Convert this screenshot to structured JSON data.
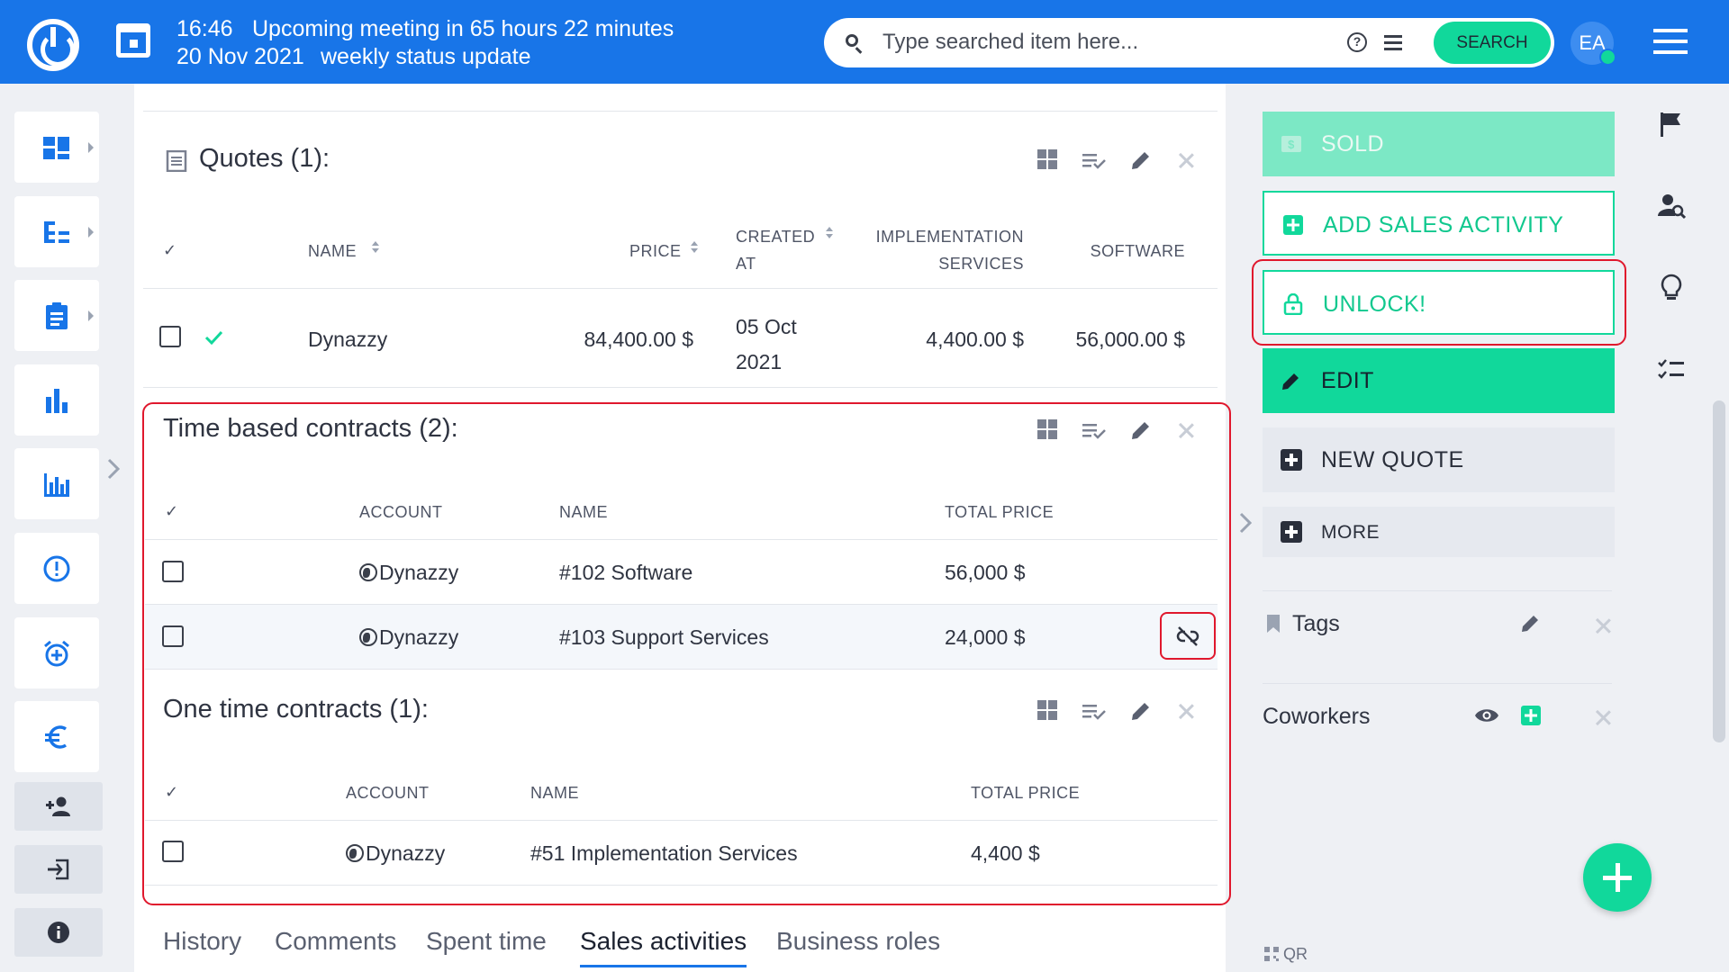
{
  "header": {
    "time": "16:46",
    "date": "20 Nov 2021",
    "meeting_line1": "Upcoming meeting in 65 hours 22 minutes",
    "meeting_line2": "weekly status update",
    "search_placeholder": "Type searched item here...",
    "search_button": "SEARCH",
    "avatar_initials": "EA"
  },
  "quotes": {
    "title": "Quotes (1):",
    "columns": {
      "check": "✓",
      "name": "NAME",
      "price": "PRICE",
      "created_1": "CREATED",
      "created_2": "AT",
      "impl_1": "IMPLEMENTATION",
      "impl_2": "SERVICES",
      "software": "SOFTWARE"
    },
    "rows": [
      {
        "name": "Dynazzy",
        "price": "84,400.00 $",
        "created_1": "05 Oct",
        "created_2": "2021",
        "impl": "4,400.00 $",
        "software": "56,000.00 $"
      }
    ]
  },
  "time_contracts": {
    "title": "Time based contracts (2):",
    "columns": {
      "check": "✓",
      "account": "ACCOUNT",
      "name": "NAME",
      "total": "TOTAL PRICE"
    },
    "rows": [
      {
        "account": "Dynazzy",
        "name": "#102 Software",
        "total": "56,000 $"
      },
      {
        "account": "Dynazzy",
        "name": "#103 Support Services",
        "total": "24,000 $"
      }
    ]
  },
  "one_time_contracts": {
    "title": "One time contracts (1):",
    "columns": {
      "check": "✓",
      "account": "ACCOUNT",
      "name": "NAME",
      "total": "TOTAL PRICE"
    },
    "rows": [
      {
        "account": "Dynazzy",
        "name": "#51 Implementation Services",
        "total": "4,400 $"
      }
    ]
  },
  "tabs": [
    "History",
    "Comments",
    "Spent time",
    "Sales activities",
    "Business roles"
  ],
  "active_tab": "Sales activities",
  "actions": {
    "sold": "SOLD",
    "add_sales": "ADD SALES ACTIVITY",
    "unlock": "UNLOCK!",
    "edit": "EDIT",
    "new_quote": "NEW QUOTE",
    "more": "MORE"
  },
  "right_sections": {
    "tags": "Tags",
    "coworkers": "Coworkers",
    "qr": "QR"
  },
  "colors": {
    "topbar": "#1875e8",
    "accent_green": "#11d89b",
    "highlight_red": "#e0182d",
    "sidebar_icon": "#1875e8"
  },
  "icons": {
    "sidebar": [
      "dashboard-icon",
      "hierarchy-icon",
      "clipboard-icon",
      "bar-chart-icon",
      "chart-icon",
      "alert-icon",
      "alarm-icon",
      "euro-icon",
      "add-user-icon",
      "login-icon",
      "info-icon"
    ],
    "far_right": [
      "flag-icon",
      "user-search-icon",
      "lightbulb-icon",
      "checklist-icon"
    ]
  }
}
